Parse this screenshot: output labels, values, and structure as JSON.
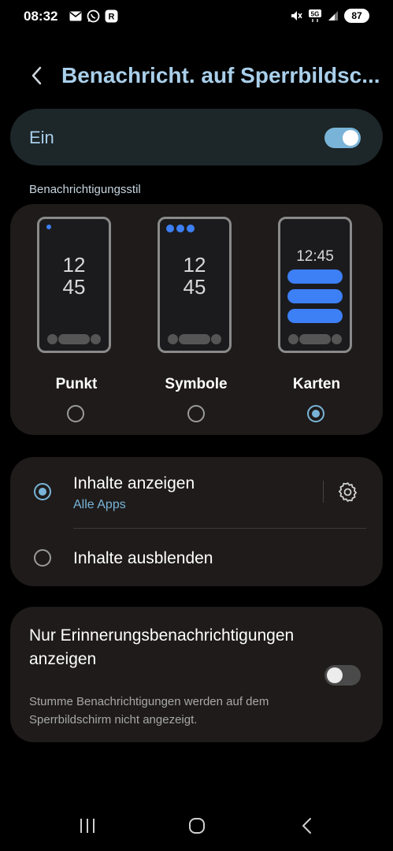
{
  "status_bar": {
    "time": "08:32",
    "left_icons": [
      "mail-icon",
      "whatsapp-icon",
      "r-app-icon"
    ],
    "right_icons": [
      "mute-icon",
      "5g-icon",
      "signal-icon"
    ],
    "network_label": "5G",
    "battery": "87"
  },
  "header": {
    "title": "Benachricht. auf Sperrbildsc..."
  },
  "main_toggle": {
    "label": "Ein",
    "state": "on"
  },
  "style_section": {
    "label": "Benachrichtigungsstil",
    "options": [
      {
        "name": "Punkt",
        "selected": false,
        "clock_line1": "12",
        "clock_line2": "45"
      },
      {
        "name": "Symbole",
        "selected": false,
        "clock_line1": "12",
        "clock_line2": "45"
      },
      {
        "name": "Karten",
        "selected": true,
        "clock": "12:45"
      }
    ]
  },
  "content_options": {
    "show": {
      "label": "Inhalte anzeigen",
      "sub": "Alle Apps",
      "selected": true
    },
    "hide": {
      "label": "Inhalte ausblenden",
      "selected": false
    }
  },
  "reminder": {
    "title": "Nur Erinnerungsbenachrichtigungen anzeigen",
    "description": "Stumme Benachrichtigungen werden auf dem Sperrbildschirm nicht angezeigt.",
    "state": "off"
  },
  "colors": {
    "accent": "#79b4d8",
    "title": "#a9cfea",
    "card": "#1e1b1a",
    "card_bars": "#3d7ff5"
  }
}
